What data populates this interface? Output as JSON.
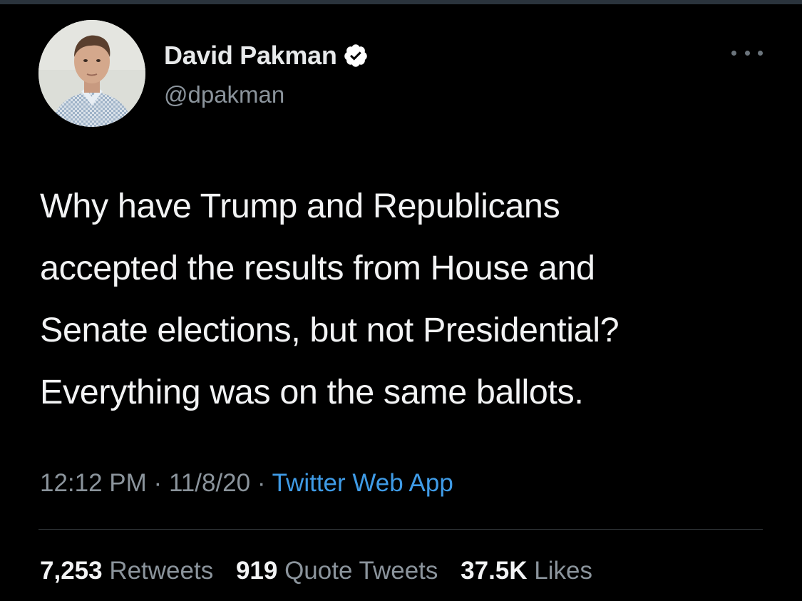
{
  "tweet": {
    "author": {
      "display_name": "David Pakman",
      "handle": "@dpakman",
      "verified": true,
      "verified_icon": "verified-badge-icon",
      "avatar_icon": "profile-photo"
    },
    "more_icon": "more-options-icon",
    "text_lines": [
      "Why have Trump and Republicans",
      "accepted the results from House and",
      "Senate elections, but not Presidential?",
      "Everything was on the same ballots."
    ],
    "time": "12:12 PM",
    "date": "11/8/20",
    "separator": "·",
    "source": "Twitter Web App",
    "stats": {
      "retweets_count": "7,253",
      "retweets_label": "Retweets",
      "quotes_count": "919",
      "quotes_label": "Quote Tweets",
      "likes_count": "37.5K",
      "likes_label": "Likes"
    },
    "colors": {
      "background": "#000000",
      "text": "#e7e9ea",
      "secondary_text": "#8b949c",
      "link": "#3f9be6"
    }
  }
}
